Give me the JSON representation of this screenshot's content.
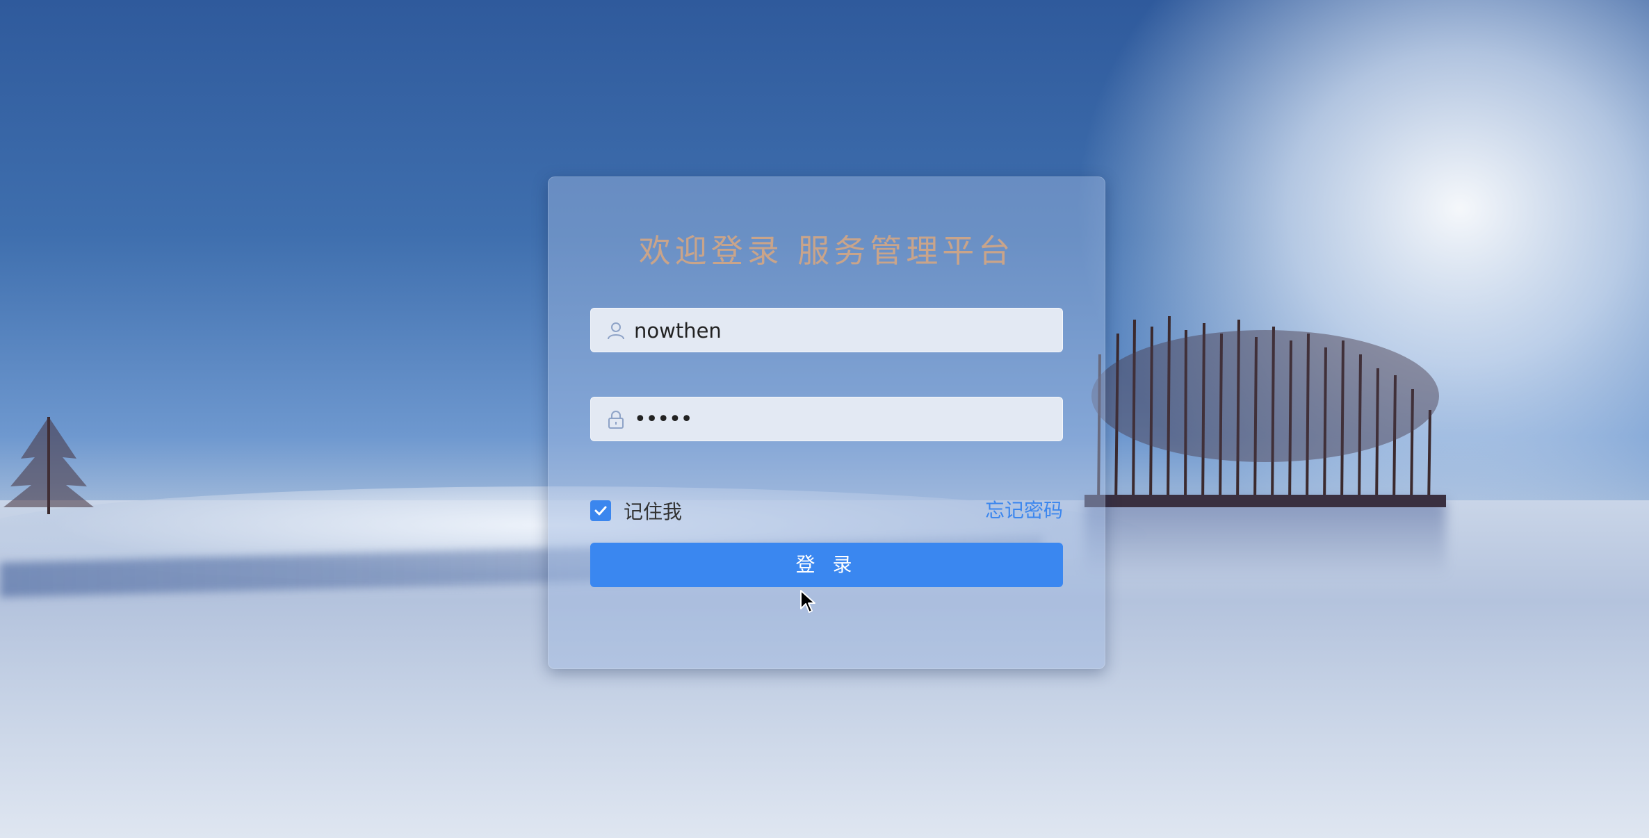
{
  "login": {
    "title": "欢迎登录 服务管理平台",
    "username_value": "nowthen",
    "password_value": "•••••",
    "remember_label": "记住我",
    "remember_checked": true,
    "forgot_label": "忘记密码",
    "submit_label": "登 录"
  },
  "icons": {
    "username": "user-icon",
    "password": "lock-icon",
    "checkbox": "check-icon"
  },
  "colors": {
    "primary": "#3a87f0",
    "title": "#c9a48a",
    "card_bg": "rgba(160,185,225,0.45)",
    "input_bg": "#e3e9f3"
  }
}
